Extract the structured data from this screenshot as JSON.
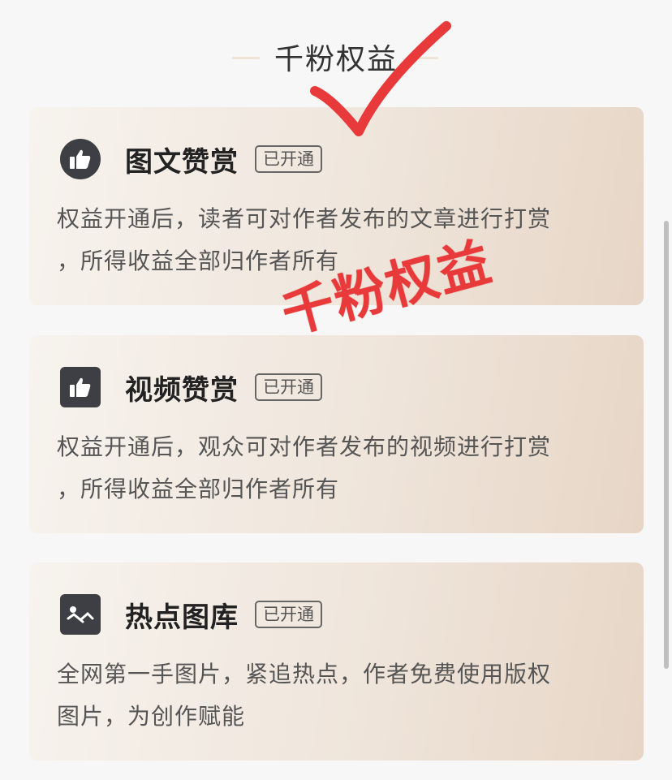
{
  "section": {
    "title": "千粉权益"
  },
  "stamp_text": "千粉权益",
  "cards": [
    {
      "icon": "thumbs-up-icon",
      "title": "图文赞赏",
      "badge": "已开通",
      "desc_line1": "权益开通后，读者可对作者发布的文章进行打赏",
      "desc_line2": "，所得收益全部归作者所有"
    },
    {
      "icon": "thumbs-up-icon",
      "title": "视频赞赏",
      "badge": "已开通",
      "desc_line1": "权益开通后，观众可对作者发布的视频进行打赏",
      "desc_line2": "，所得收益全部归作者所有"
    },
    {
      "icon": "image-icon",
      "title": "热点图库",
      "badge": "已开通",
      "desc_line1": "全网第一手图片，紧追热点，作者免费使用版权",
      "desc_line2": "图片，为创作赋能"
    }
  ],
  "colors": {
    "stamp": "#e83a3a",
    "icon_bg": "#3e3f45",
    "accent_line": "#efe3d6"
  }
}
